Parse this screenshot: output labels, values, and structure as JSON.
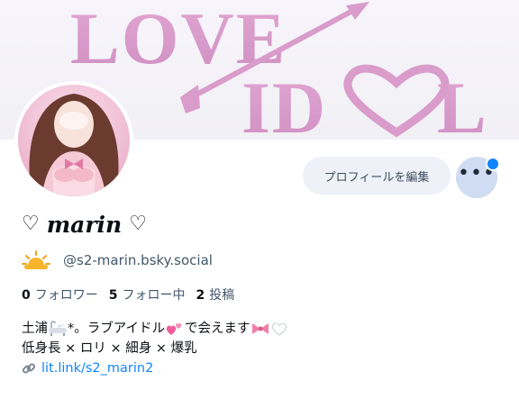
{
  "banner": {
    "line1": "LOVE",
    "line2": "IDOL"
  },
  "profile": {
    "display_name": "marin",
    "name_prefix_icon": "heart-outline",
    "name_suffix_icon": "heart-outline",
    "handle": "@s2-marin.bsky.social",
    "status_icon": "sun-behind-cloud-icon"
  },
  "actions": {
    "edit_profile_label": "プロフィールを編集",
    "more_label": "•••",
    "notification_dot_color": "#1083fe"
  },
  "stats": {
    "followers_count": "0",
    "followers_label": "フォロワー",
    "following_count": "5",
    "following_label": "フォロー中",
    "posts_count": "2",
    "posts_label": "投稿"
  },
  "bio": {
    "line1_part1": "土浦",
    "line1_part2": "*。ラブアイドル",
    "line1_part3": "で会えます",
    "line2": "低身長 × ロリ × 細身 × 爆乳",
    "link_text": "lit.link/s2_marin2"
  },
  "colors": {
    "accent": "#1083fe",
    "banner_pink": "#d69bc9",
    "text_primary": "#0b0f14",
    "text_secondary": "#42576c"
  }
}
